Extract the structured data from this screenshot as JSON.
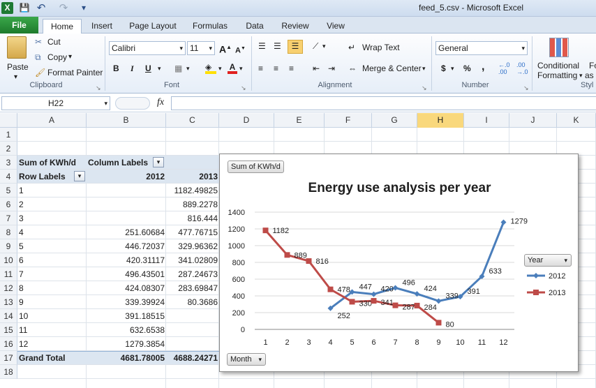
{
  "app": {
    "title": "feed_5.csv  -  Microsoft Excel",
    "quick_access": [
      "X",
      "💾",
      "↶",
      "↷",
      "▾"
    ]
  },
  "tabs": [
    "File",
    "Home",
    "Insert",
    "Page Layout",
    "Formulas",
    "Data",
    "Review",
    "View"
  ],
  "ribbon": {
    "clipboard": {
      "paste": "Paste",
      "cut": "Cut",
      "copy": "Copy",
      "format_painter": "Format Painter",
      "label": "Clipboard"
    },
    "font": {
      "name": "Calibri",
      "size": "11",
      "bold": "B",
      "italic": "I",
      "underline": "U",
      "label": "Font"
    },
    "alignment": {
      "wrap": "Wrap Text",
      "merge": "Merge & Center",
      "label": "Alignment"
    },
    "number": {
      "format": "General",
      "currency": "$",
      "percent": "%",
      "comma": ",",
      "label": "Number"
    },
    "styles": {
      "conditional": "Conditional",
      "formatting": "Formatting",
      "fo": "Fo",
      "as": "as",
      "label": "Styl"
    }
  },
  "formula_bar": {
    "name_box": "H22",
    "fx": "fx",
    "value": ""
  },
  "columns": [
    "A",
    "B",
    "C",
    "D",
    "E",
    "F",
    "G",
    "H",
    "I",
    "J",
    "K"
  ],
  "selected_column": "H",
  "rows": [
    "1",
    "2",
    "3",
    "4",
    "5",
    "6",
    "7",
    "8",
    "9",
    "10",
    "11",
    "12",
    "13",
    "14",
    "15",
    "16",
    "17",
    "18"
  ],
  "pivot": {
    "header_a": "Sum of KWh/d",
    "header_b": "Column Labels",
    "row_labels": "Row Labels",
    "year_2012": "2012",
    "year_2013": "2013",
    "data": [
      {
        "label": "1",
        "y2012": "",
        "y2013": "1182.49825"
      },
      {
        "label": "2",
        "y2012": "",
        "y2013": "889.2278"
      },
      {
        "label": "3",
        "y2012": "",
        "y2013": "816.444"
      },
      {
        "label": "4",
        "y2012": "251.60684",
        "y2013": "477.76715"
      },
      {
        "label": "5",
        "y2012": "446.72037",
        "y2013": "329.96362"
      },
      {
        "label": "6",
        "y2012": "420.31117",
        "y2013": "341.02809"
      },
      {
        "label": "7",
        "y2012": "496.43501",
        "y2013": "287.24673"
      },
      {
        "label": "8",
        "y2012": "424.08307",
        "y2013": "283.69847"
      },
      {
        "label": "9",
        "y2012": "339.39924",
        "y2013": "80.3686"
      },
      {
        "label": "10",
        "y2012": "391.18515",
        "y2013": ""
      },
      {
        "label": "11",
        "y2012": "632.6538",
        "y2013": ""
      },
      {
        "label": "12",
        "y2012": "1279.3854",
        "y2013": ""
      }
    ],
    "grand_total_label": "Grand Total",
    "grand_total_2012": "4681.78005",
    "grand_total_2013": "4688.24271"
  },
  "chart_data": {
    "type": "line",
    "title": "Energy use analysis per year",
    "value_button": "Sum of KWh/d",
    "axis_button": "Month",
    "legend_title": "Year",
    "legend_position": "right",
    "ylim": [
      0,
      1400
    ],
    "yticks": [
      0,
      200,
      400,
      600,
      800,
      1000,
      1200,
      1400
    ],
    "categories": [
      "1",
      "2",
      "3",
      "4",
      "5",
      "6",
      "7",
      "8",
      "9",
      "10",
      "11",
      "12"
    ],
    "grid": true,
    "series": [
      {
        "name": "2012",
        "color": "#4a7ebb",
        "marker": "diamond",
        "values": [
          null,
          null,
          null,
          252,
          447,
          420,
          496,
          424,
          339,
          391,
          633,
          1279
        ]
      },
      {
        "name": "2013",
        "color": "#be4b48",
        "marker": "square",
        "values": [
          1182,
          889,
          816,
          478,
          330,
          341,
          287,
          284,
          80,
          null,
          null,
          null
        ]
      }
    ]
  }
}
